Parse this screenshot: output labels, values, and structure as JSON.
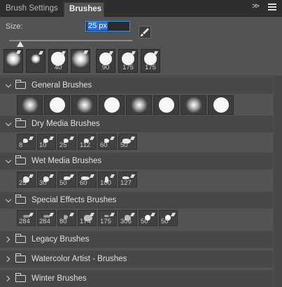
{
  "tabs": [
    {
      "label": "Brush Settings"
    },
    {
      "label": "Brushes"
    }
  ],
  "menu": {
    "collapse": ">>"
  },
  "size": {
    "label": "Size:",
    "value": "25 px"
  },
  "recent": [
    {
      "value": ""
    },
    {
      "value": ""
    },
    {
      "value": "40"
    },
    {
      "value": ""
    },
    {
      "value": "90"
    },
    {
      "value": "175"
    },
    {
      "value": "175"
    }
  ],
  "groups": [
    {
      "name": "General Brushes",
      "expanded": true,
      "items": []
    },
    {
      "name": "Dry Media Brushes",
      "expanded": true,
      "items": [
        "8",
        "10",
        "25",
        "112",
        "60",
        "50"
      ]
    },
    {
      "name": "Wet Media Brushes",
      "expanded": true,
      "items": [
        "25",
        "30",
        "50",
        "60",
        "100",
        "127"
      ]
    },
    {
      "name": "Special Effects Brushes",
      "expanded": true,
      "items": [
        "284",
        "284",
        "80",
        "174",
        "175",
        "306",
        "50",
        "50"
      ]
    },
    {
      "name": "Legacy Brushes",
      "expanded": false
    },
    {
      "name": "Watercolor Artist - Brushes",
      "expanded": false
    },
    {
      "name": "Winter Brushes",
      "expanded": false
    }
  ]
}
